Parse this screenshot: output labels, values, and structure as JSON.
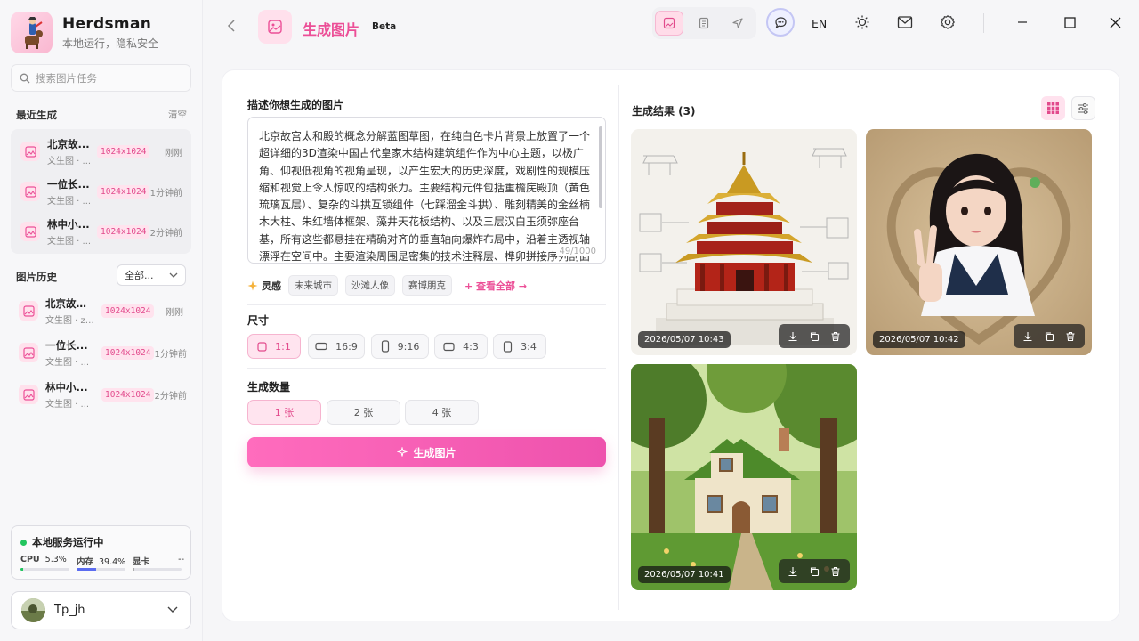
{
  "app": {
    "name": "Herdsman",
    "tagline": "本地运行，隐私安全"
  },
  "sidebar": {
    "search_placeholder": "搜索图片任务",
    "recent_title": "最近生成",
    "clear_label": "清空",
    "recent": [
      {
        "title": "北京故...",
        "sub": "文生图 · ...",
        "size": "1024x1024",
        "time": "刚刚"
      },
      {
        "title": "一位长...",
        "sub": "文生图 · ...",
        "size": "1024x1024",
        "time": "1分钟前"
      },
      {
        "title": "林中小...",
        "sub": "文生图 · ...",
        "size": "1024x1024",
        "time": "2分钟前"
      }
    ],
    "history_title": "图片历史",
    "history_filter": "全部...",
    "history": [
      {
        "title": "北京故宫...",
        "sub": "文生图 · zi...",
        "size": "1024x1024",
        "time": "刚刚"
      },
      {
        "title": "一位长...",
        "sub": "文生图 · ...",
        "size": "1024x1024",
        "time": "1分钟前"
      },
      {
        "title": "林中小...",
        "sub": "文生图 · ...",
        "size": "1024x1024",
        "time": "2分钟前"
      }
    ],
    "status": {
      "title": "本地服务运行中",
      "cpu_label": "CPU",
      "cpu_value": "5.3%",
      "cpu_fraction": 0.053,
      "mem_label": "内存",
      "mem_value": "39.4%",
      "mem_fraction": 0.394,
      "gpu_label": "显卡",
      "gpu_value": "--"
    },
    "user": {
      "name": "Tp_jh"
    }
  },
  "header": {
    "title": "生成图片",
    "badge": "Beta",
    "lang": "EN",
    "accent": "#ec4f97"
  },
  "form": {
    "prompt_label": "描述你想生成的图片",
    "prompt_text": "北京故宫太和殿的概念分解蓝图草图，在纯白色卡片背景上放置了一个超详细的3D渲染中国古代皇家木结构建筑组件作为中心主题，以极广角、仰视低视角的视角呈现，以产生宏大的历史深度，戏剧性的规模压缩和视觉上令人惊叹的结构张力。主要结构元件包括重檐庑殿顶（黄色琉璃瓦层）、复杂的斗拱互锁组件（七踩溜金斗拱）、雕刻精美的金丝楠木大柱、朱红墙体框架、藻井天花板结构、以及三层汉白玉须弥座台基，所有这些都悬挂在精确对齐的垂直轴向爆炸布局中，沿着主透视轴漂浮在空间中。主要渲染周围是密集的技术注释层、榫卯拼接序列剖面图、屋顶荷载传递路径图、藻井表学图案分析、彩",
    "char_count": "49/1000",
    "inspiration_label": "灵感",
    "inspirations": [
      "未来城市",
      "沙滩人像",
      "赛博朋克"
    ],
    "view_all": "+ 查看全部 →",
    "size_label": "尺寸",
    "sizes": [
      "1:1",
      "16:9",
      "9:16",
      "4:3",
      "3:4"
    ],
    "count_label": "生成数量",
    "counts": [
      "1 张",
      "2 张",
      "4 张"
    ],
    "generate_label": "生成图片"
  },
  "results": {
    "title": "生成结果 (3)",
    "items": [
      {
        "timestamp": "2026/05/07 10:43",
        "subject": "palace-blueprint"
      },
      {
        "timestamp": "2026/05/07 10:42",
        "subject": "girl-in-sand-heart"
      },
      {
        "timestamp": "2026/05/07 10:41",
        "subject": "forest-cottage"
      }
    ]
  }
}
